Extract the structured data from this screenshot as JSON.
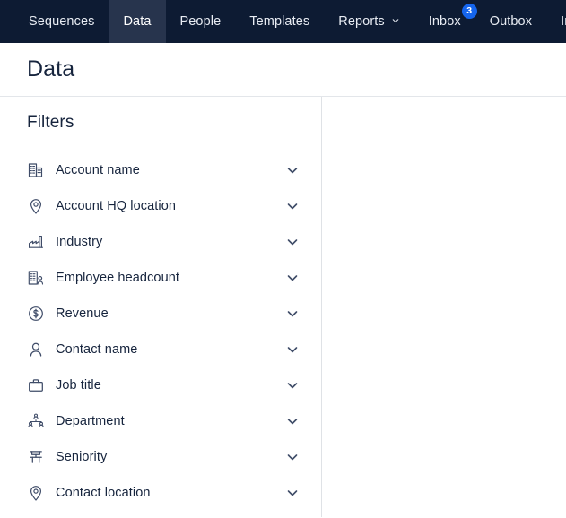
{
  "nav": {
    "items": [
      {
        "label": "Sequences",
        "icon": null,
        "active": false,
        "badge": null
      },
      {
        "label": "Data",
        "icon": null,
        "active": true,
        "badge": null
      },
      {
        "label": "People",
        "icon": null,
        "active": false,
        "badge": null
      },
      {
        "label": "Templates",
        "icon": null,
        "active": false,
        "badge": null
      },
      {
        "label": "Reports",
        "icon": "chevron-down-icon",
        "active": false,
        "badge": null
      },
      {
        "label": "Inbox",
        "icon": null,
        "active": false,
        "badge": "3"
      },
      {
        "label": "Outbox",
        "icon": null,
        "active": false,
        "badge": null
      },
      {
        "label": "In",
        "icon": null,
        "active": false,
        "badge": null
      }
    ],
    "background_color": "#0d1b33",
    "active_background_color": "#27344d",
    "badge_color": "#1565ed"
  },
  "header": {
    "title": "Data"
  },
  "filters": {
    "title": "Filters",
    "items": [
      {
        "label": "Account name",
        "icon": "building-icon",
        "chevron": "chevron-down-icon"
      },
      {
        "label": "Account HQ location",
        "icon": "map-pin-icon",
        "chevron": "chevron-down-icon"
      },
      {
        "label": "Industry",
        "icon": "factory-icon",
        "chevron": "chevron-down-icon"
      },
      {
        "label": "Employee headcount",
        "icon": "building-person-icon",
        "chevron": "chevron-down-icon"
      },
      {
        "label": "Revenue",
        "icon": "dollar-circle-icon",
        "chevron": "chevron-down-icon"
      },
      {
        "label": "Contact name",
        "icon": "person-icon",
        "chevron": "chevron-down-icon"
      },
      {
        "label": "Job title",
        "icon": "briefcase-icon",
        "chevron": "chevron-down-icon"
      },
      {
        "label": "Department",
        "icon": "org-chart-icon",
        "chevron": "chevron-down-icon"
      },
      {
        "label": "Seniority",
        "icon": "podium-icon",
        "chevron": "chevron-down-icon"
      },
      {
        "label": "Contact location",
        "icon": "map-pin-icon",
        "chevron": "chevron-down-icon"
      }
    ]
  },
  "theme": {
    "text_dark": "#16243d",
    "icon_color": "#3f4c68",
    "divider": "#dfe2e6"
  }
}
